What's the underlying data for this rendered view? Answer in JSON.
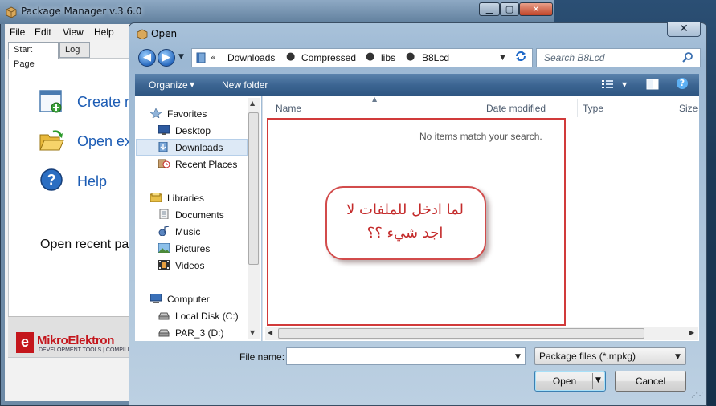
{
  "colors": {
    "accent_red": "#d13a3a",
    "link_blue": "#1c5cb4",
    "toolbar_blue": "#3c6592",
    "brand_red": "#c4161c"
  },
  "pm": {
    "title": "Package Manager v.3.6.0",
    "caption_min": "▁",
    "caption_max": "▢",
    "caption_close": "✕",
    "menu": [
      "File",
      "Edit",
      "View",
      "Help"
    ],
    "tabs": [
      "Start Page",
      "Log"
    ],
    "links": [
      {
        "label": "Create n",
        "icon": "new-package-icon"
      },
      {
        "label": "Open ex",
        "icon": "open-folder-icon"
      },
      {
        "label": "Help",
        "icon": "help-icon"
      }
    ],
    "recent": "Open recent pa",
    "logo_letter": "e",
    "logo_text": "MikroElektron",
    "logo_tagline": "DEVELOPMENT TOOLS | COMPILERS"
  },
  "dialog": {
    "title": "Open",
    "close": "✕",
    "nav_back": "◀",
    "nav_fwd": "▶",
    "address_chevron": "«",
    "crumbs": [
      "Downloads",
      "Compressed",
      "libs",
      "B8Lcd"
    ],
    "crumb_sep": "▸",
    "search_placeholder": "Search B8Lcd",
    "toolbar": {
      "organize": "Organize",
      "new_folder": "New folder",
      "help": "?"
    },
    "nav_items": [
      {
        "label": "Favorites",
        "icon": "star-icon",
        "group": true
      },
      {
        "label": "Desktop",
        "icon": "desktop-icon"
      },
      {
        "label": "Downloads",
        "icon": "downloads-icon",
        "selected": true
      },
      {
        "label": "Recent Places",
        "icon": "recent-places-icon"
      },
      {
        "label": "Libraries",
        "icon": "library-icon",
        "group": true
      },
      {
        "label": "Documents",
        "icon": "documents-icon"
      },
      {
        "label": "Music",
        "icon": "music-icon"
      },
      {
        "label": "Pictures",
        "icon": "pictures-icon"
      },
      {
        "label": "Videos",
        "icon": "videos-icon"
      },
      {
        "label": "Computer",
        "icon": "computer-icon",
        "group": true
      },
      {
        "label": "Local Disk (C:)",
        "icon": "disk-icon"
      },
      {
        "label": "PAR_3 (D:)",
        "icon": "disk-icon"
      }
    ],
    "columns": [
      "Name",
      "Date modified",
      "Type",
      "Size"
    ],
    "empty_message": "No items match your search.",
    "annotation_line1": "لما ادخل للملفات لا",
    "annotation_line2": "اجد شيء ؟؟",
    "file_name_label": "File name:",
    "file_name_value": "",
    "file_type": "Package files (*.mpkg)",
    "open_label": "Open",
    "cancel_label": "Cancel"
  }
}
